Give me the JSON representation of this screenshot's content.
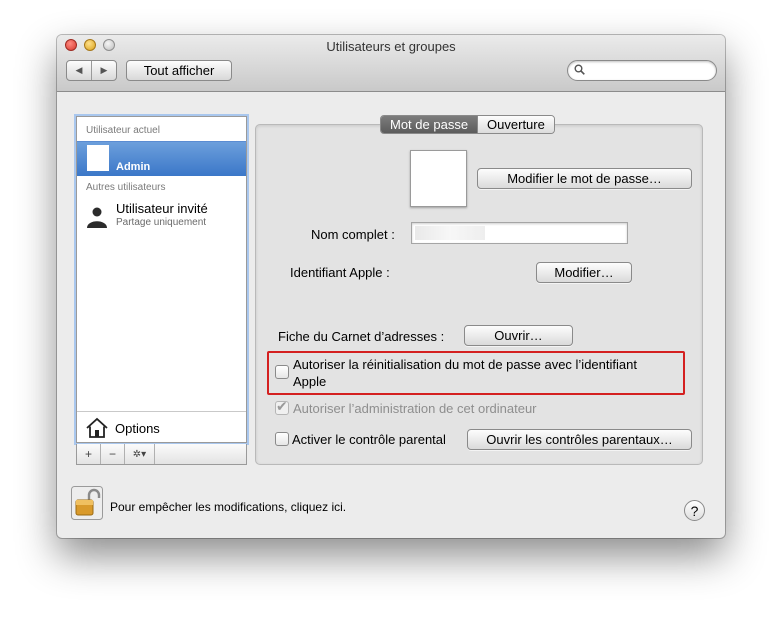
{
  "window": {
    "title": "Utilisateurs et groupes"
  },
  "toolbar": {
    "back": "◀",
    "forward": "▶",
    "show_all": "Tout afficher",
    "search_placeholder": ""
  },
  "sidebar": {
    "current_user_header": "Utilisateur actuel",
    "current_user": {
      "name": "Admin",
      "selected": true
    },
    "other_users_header": "Autres utilisateurs",
    "guest": {
      "name": "Utilisateur invité",
      "subtitle": "Partage uniquement"
    },
    "options_label": "Options",
    "bar": {
      "add": "+",
      "remove": "−",
      "action": "✲▾"
    }
  },
  "tabs": [
    {
      "label": "Mot de passe",
      "active": true
    },
    {
      "label": "Ouverture",
      "active": false
    }
  ],
  "account": {
    "change_password_button": "Modifier le mot de passe…",
    "full_name_label": "Nom complet :",
    "full_name_value": "",
    "apple_id_label": "Identifiant Apple :",
    "apple_id_button": "Modifier…",
    "address_book_label": "Fiche du Carnet d’adresses :",
    "address_book_button": "Ouvrir…",
    "allow_reset_label_line1": "Autoriser la réinitialisation du mot de passe avec l’identifiant",
    "allow_reset_label_line2": "Apple",
    "allow_reset_checked": false,
    "allow_admin_label": "Autoriser l’administration de cet ordinateur",
    "allow_admin_checked": true,
    "allow_admin_disabled": true,
    "parental_label": "Activer le contrôle parental",
    "parental_checked": false,
    "parental_button": "Ouvrir les contrôles parentaux…"
  },
  "footer": {
    "lock_text": "Pour empêcher les modifications, cliquez ici.",
    "help": "?"
  },
  "colors": {
    "highlight_box": "#d42020",
    "selection": "#3b77c8"
  }
}
